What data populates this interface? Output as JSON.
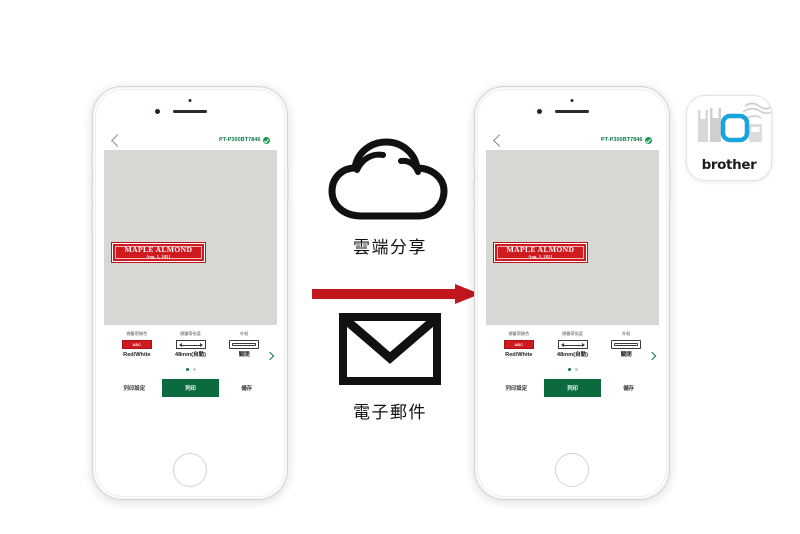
{
  "page": {
    "background": "#ffffff",
    "accent_green": "#0c6b3e",
    "accent_red": "#cf1a20",
    "arrow_color": "#c1161c"
  },
  "phones": [
    {
      "id": "left-phone",
      "nav": {
        "back_icon": "chevron-left-icon",
        "printer_name": "PT-P300BT7846",
        "connected_icon": "check-badge-icon"
      },
      "canvas": {
        "label": {
          "title": "MAPLE ALMOND",
          "date": "Aug. 1, 2021",
          "color": "#cf1a20"
        }
      },
      "options": [
        {
          "label": "標籤帶顏色",
          "icon": "tape-color-swatch-icon",
          "swatch_text": "ABC",
          "value": "Red/White"
        },
        {
          "label": "標籤帶長度",
          "icon": "tape-length-icon",
          "value": "48mm(自動)"
        },
        {
          "label": "外框",
          "icon": "frame-icon",
          "value": "關閉"
        }
      ],
      "next_icon": "chevron-right-icon",
      "pager": {
        "total": 2,
        "active": 0
      },
      "actions": {
        "settings": "列印設定",
        "print": "列印",
        "save": "儲存"
      }
    },
    {
      "id": "right-phone",
      "nav": {
        "back_icon": "chevron-left-icon",
        "printer_name": "PT-P300BT7846",
        "connected_icon": "check-badge-icon"
      },
      "canvas": {
        "label": {
          "title": "MAPLE ALMOND",
          "date": "Aug. 1, 2021",
          "color": "#cf1a20"
        }
      },
      "options": [
        {
          "label": "標籤帶顏色",
          "icon": "tape-color-swatch-icon",
          "swatch_text": "ABC",
          "value": "Red/White"
        },
        {
          "label": "標籤帶長度",
          "icon": "tape-length-icon",
          "value": "48mm(自動)"
        },
        {
          "label": "外框",
          "icon": "frame-icon",
          "value": "關閉"
        }
      ],
      "next_icon": "chevron-right-icon",
      "pager": {
        "total": 2,
        "active": 0
      },
      "actions": {
        "settings": "列印設定",
        "print": "列印",
        "save": "儲存"
      }
    }
  ],
  "middle": {
    "cloud": {
      "icon": "cloud-icon",
      "caption": "雲端分享"
    },
    "arrow": {
      "icon": "arrow-right-icon"
    },
    "mail": {
      "icon": "envelope-icon",
      "caption": "電子郵件"
    }
  },
  "brother_badge": {
    "icon": "brother-app-icon",
    "wordmark": "brother"
  }
}
